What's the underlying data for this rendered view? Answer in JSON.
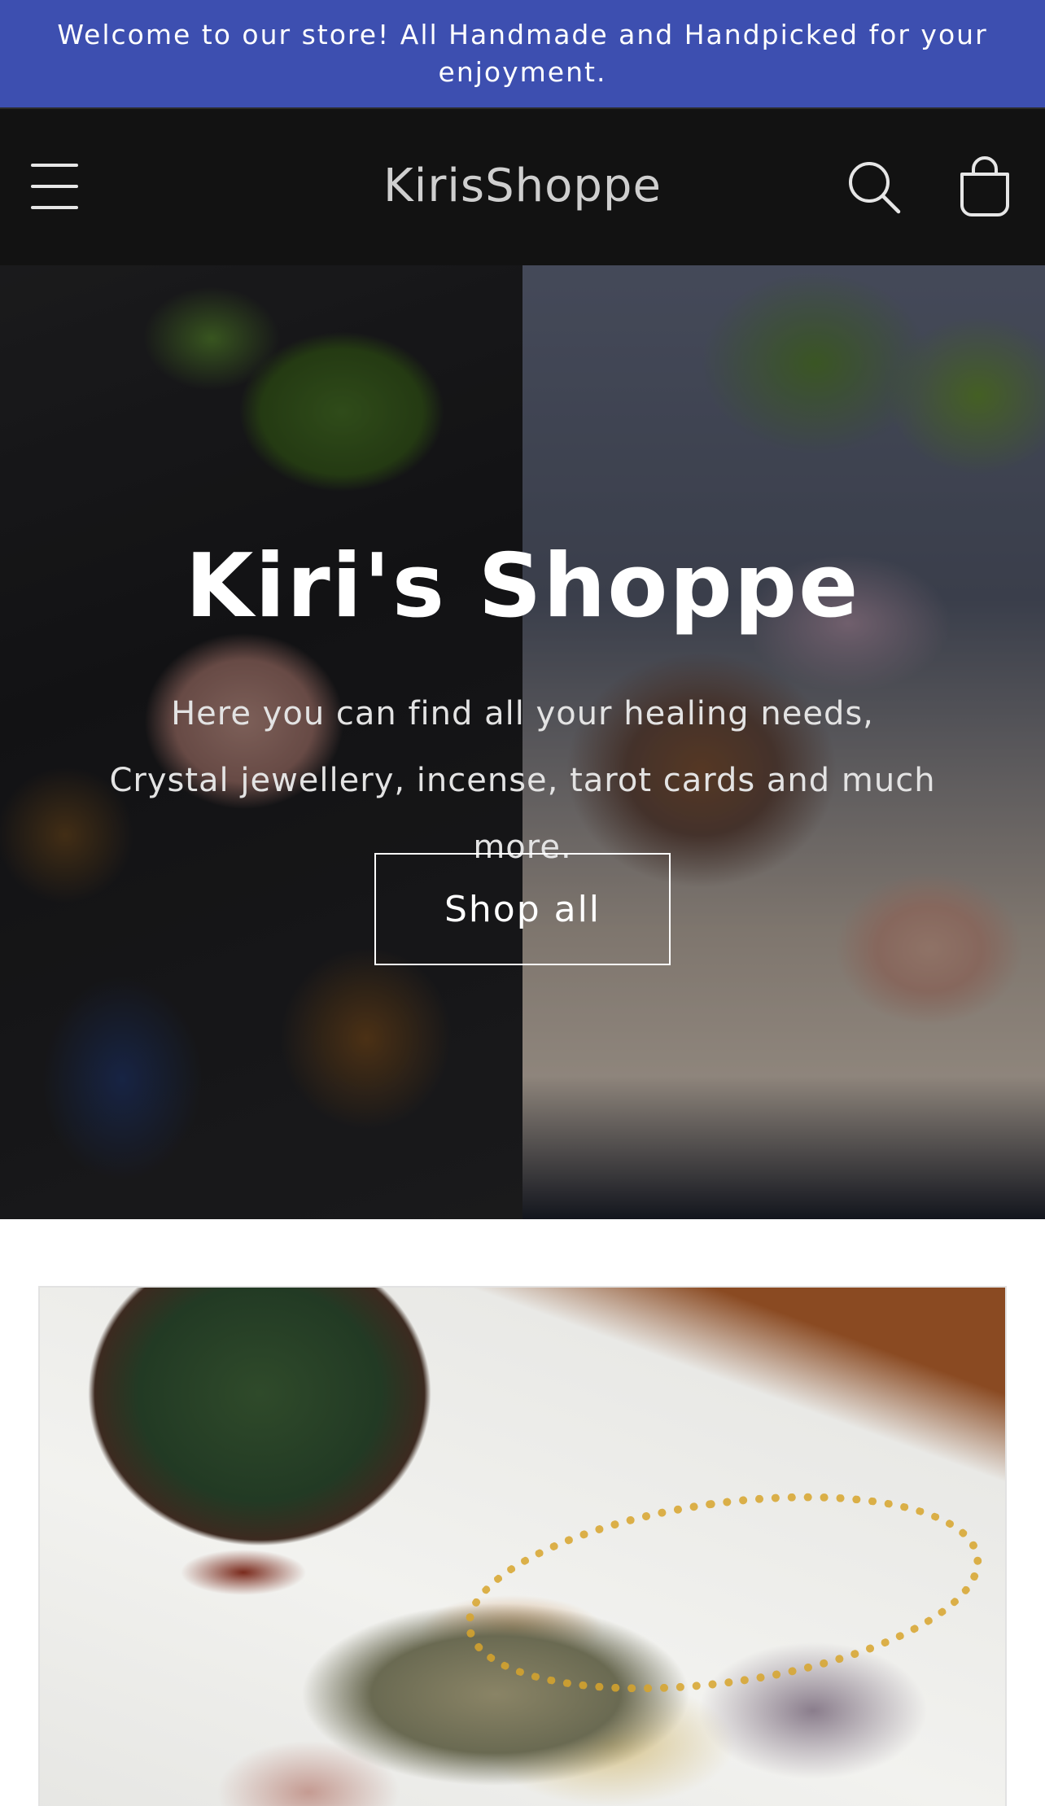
{
  "announcement": {
    "text": "Welcome to our store! All Handmade and Handpicked for your enjoyment."
  },
  "header": {
    "store_name": "KirisShoppe",
    "icons": [
      "menu-icon",
      "search-icon",
      "cart-icon"
    ]
  },
  "hero": {
    "title": "Kiri's Shoppe",
    "subtitle": "Here you can find all your healing needs, Crystal jewellery, incense, tarot cards and much more.",
    "cta_label": "Shop all"
  },
  "colors": {
    "announcement_bg": "#3d4fb0",
    "header_bg": "#121212",
    "header_text": "#cfcfcf",
    "hero_text": "#ffffff"
  }
}
